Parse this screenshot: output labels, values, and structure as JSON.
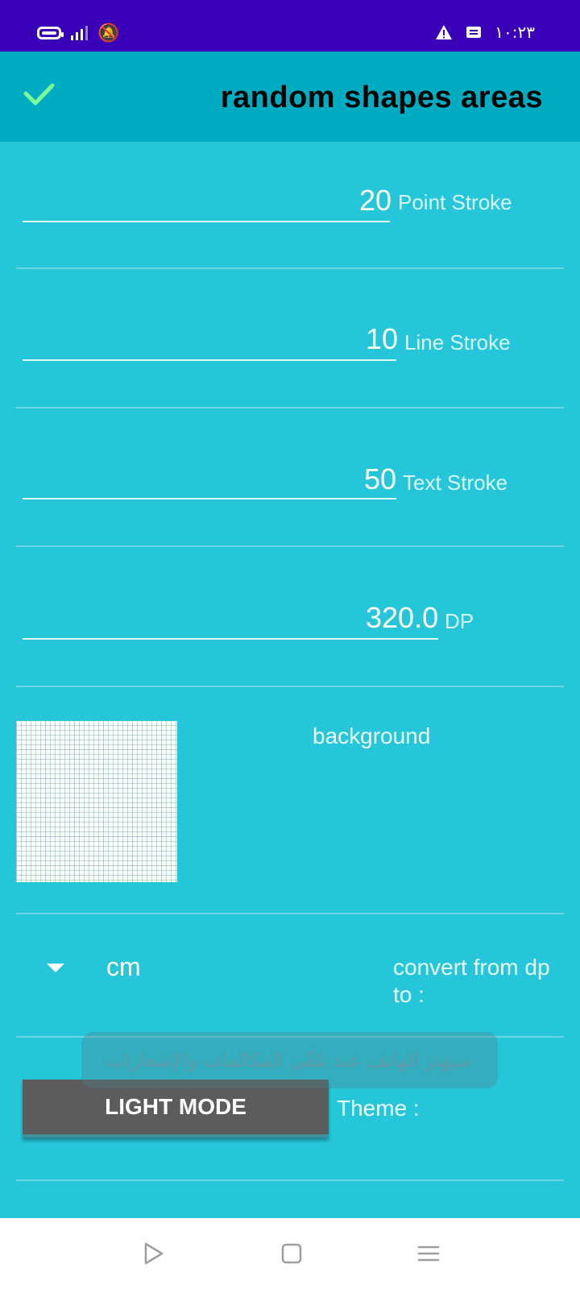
{
  "status_bar": {
    "time": "١٠:٢٣",
    "icons": [
      "battery-icon",
      "signal-icon",
      "mute-icon",
      "warning-icon",
      "message-icon"
    ]
  },
  "app_bar": {
    "title": "random shapes areas",
    "confirm_icon": "check-icon"
  },
  "fields": [
    {
      "value": "20",
      "label": "Point Stroke"
    },
    {
      "value": "10",
      "label": "Line Stroke"
    },
    {
      "value": "50",
      "label": "Text Stroke"
    },
    {
      "value": "320.0",
      "label": "DP"
    }
  ],
  "background": {
    "label": "background"
  },
  "conversion": {
    "selected_unit": "cm",
    "label": "convert from dp to :"
  },
  "theme": {
    "button_label": "LIGHT MODE",
    "label": "Theme :"
  },
  "toast": {
    "message": "سيهتز الهاتف عند تلقّي المكالمات والإشعارات"
  },
  "nav": {
    "icons": [
      "back-icon",
      "home-icon",
      "menu-icon"
    ]
  },
  "colors": {
    "status_bar": "#3a00b7",
    "app_bar": "#00acc1",
    "content_bg": "#26c6da",
    "accent_check": "#7CFF9A"
  }
}
